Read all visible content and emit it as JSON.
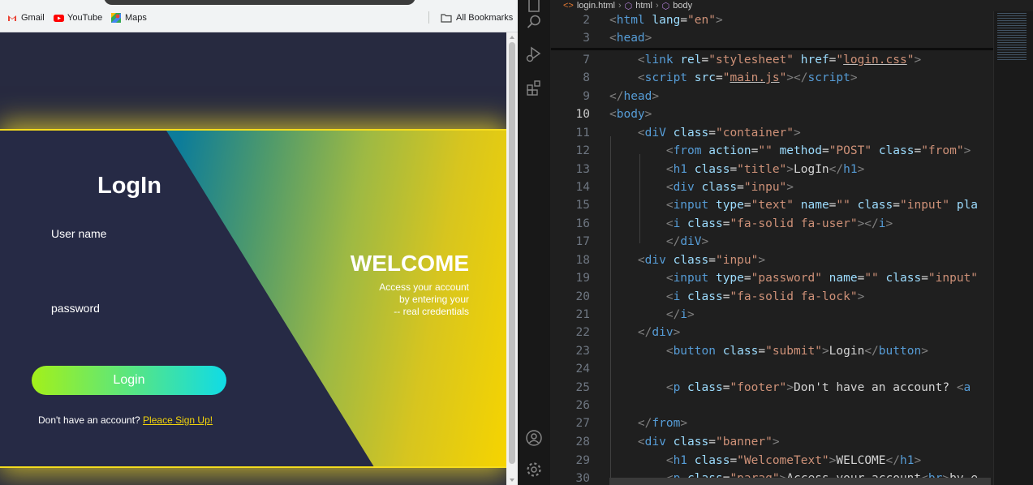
{
  "browser": {
    "bookmarks": {
      "gmail": "Gmail",
      "youtube": "YouTube",
      "maps": "Maps",
      "all_bookmarks": "All Bookmarks"
    },
    "login_page": {
      "title": "LogIn",
      "username_label": "User name",
      "password_label": "password",
      "login_button": "Login",
      "footer_text": "Don't have an account? ",
      "signup_link": "Pleace Sign Up!",
      "welcome_title": "WELCOME",
      "welcome_lines": [
        "Access your account",
        "by entering your",
        "-- real credentials"
      ]
    }
  },
  "editor": {
    "breadcrumbs": [
      "login.html",
      "html",
      "body"
    ],
    "active_line": "10",
    "lines": [
      {
        "num": "2",
        "html": "<span class=\"t\">&lt;</span><span class=\"tag\">html</span> <span class=\"at\">lang</span><span class=\"tx\">=</span><span class=\"st\">\"en\"</span><span class=\"t\">&gt;</span>"
      },
      {
        "num": "3",
        "html": "<span class=\"t\">&lt;</span><span class=\"tag\">head</span><span class=\"t\">&gt;</span>"
      },
      {
        "num": "7",
        "html": "    <span class=\"t\">&lt;</span><span class=\"tag\">link</span> <span class=\"at\">rel</span><span class=\"tx\">=</span><span class=\"st\">\"stylesheet\"</span> <span class=\"at\">href</span><span class=\"tx\">=</span><span class=\"st\">\"<span class=\"st u\">login.css</span>\"</span><span class=\"t\">&gt;</span>"
      },
      {
        "num": "8",
        "html": "    <span class=\"t\">&lt;</span><span class=\"tag\">script</span> <span class=\"at\">src</span><span class=\"tx\">=</span><span class=\"st\">\"<span class=\"st u\">main.js</span>\"</span><span class=\"t\">&gt;&lt;/</span><span class=\"tag\">script</span><span class=\"t\">&gt;</span>"
      },
      {
        "num": "9",
        "html": "<span class=\"t\">&lt;/</span><span class=\"tag\">head</span><span class=\"t\">&gt;</span>"
      },
      {
        "num": "10",
        "html": "<span class=\"t\">&lt;</span><span class=\"tag\">body</span><span class=\"t\">&gt;</span>"
      },
      {
        "num": "11",
        "html": "    <span class=\"t\">&lt;</span><span class=\"tag\">diV</span> <span class=\"at\">class</span><span class=\"tx\">=</span><span class=\"st\">\"container\"</span><span class=\"t\">&gt;</span>"
      },
      {
        "num": "12",
        "html": "        <span class=\"t\">&lt;</span><span class=\"tag\">from</span> <span class=\"at\">action</span><span class=\"tx\">=</span><span class=\"st\">\"\"</span> <span class=\"at\">method</span><span class=\"tx\">=</span><span class=\"st\">\"POST\"</span> <span class=\"at\">class</span><span class=\"tx\">=</span><span class=\"st\">\"from\"</span><span class=\"t\">&gt;</span>"
      },
      {
        "num": "13",
        "html": "        <span class=\"t\">&lt;</span><span class=\"tag\">h1</span> <span class=\"at\">class</span><span class=\"tx\">=</span><span class=\"st\">\"title\"</span><span class=\"t\">&gt;</span><span class=\"tx\">LogIn</span><span class=\"t\">&lt;/</span><span class=\"tag\">h1</span><span class=\"t\">&gt;</span>"
      },
      {
        "num": "14",
        "html": "        <span class=\"t\">&lt;</span><span class=\"tag\">div</span> <span class=\"at\">class</span><span class=\"tx\">=</span><span class=\"st\">\"inpu\"</span><span class=\"t\">&gt;</span>"
      },
      {
        "num": "15",
        "html": "        <span class=\"t\">&lt;</span><span class=\"tag\">input</span> <span class=\"at\">type</span><span class=\"tx\">=</span><span class=\"st\">\"text\"</span> <span class=\"at\">name</span><span class=\"tx\">=</span><span class=\"st\">\"\"</span> <span class=\"at\">class</span><span class=\"tx\">=</span><span class=\"st\">\"input\"</span> <span class=\"at\">pla</span>"
      },
      {
        "num": "16",
        "html": "        <span class=\"t\">&lt;</span><span class=\"tag\">i</span> <span class=\"at\">class</span><span class=\"tx\">=</span><span class=\"st\">\"fa-solid fa-user\"</span><span class=\"t\">&gt;&lt;/</span><span class=\"tag\">i</span><span class=\"t\">&gt;</span>"
      },
      {
        "num": "17",
        "html": "        <span class=\"t\">&lt;/</span><span class=\"tag\">diV</span><span class=\"t\">&gt;</span>"
      },
      {
        "num": "18",
        "html": "    <span class=\"t\">&lt;</span><span class=\"tag\">div</span> <span class=\"at\">class</span><span class=\"tx\">=</span><span class=\"st\">\"inpu\"</span><span class=\"t\">&gt;</span>"
      },
      {
        "num": "19",
        "html": "        <span class=\"t\">&lt;</span><span class=\"tag\">input</span> <span class=\"at\">type</span><span class=\"tx\">=</span><span class=\"st\">\"password\"</span> <span class=\"at\">name</span><span class=\"tx\">=</span><span class=\"st\">\"\"</span> <span class=\"at\">class</span><span class=\"tx\">=</span><span class=\"st\">\"input\"</span>"
      },
      {
        "num": "20",
        "html": "        <span class=\"t\">&lt;</span><span class=\"tag\">i</span> <span class=\"at\">class</span><span class=\"tx\">=</span><span class=\"st\">\"fa-solid fa-lock\"</span><span class=\"t\">&gt;</span>"
      },
      {
        "num": "21",
        "html": "        <span class=\"t\">&lt;/</span><span class=\"tag\">i</span><span class=\"t\">&gt;</span>"
      },
      {
        "num": "22",
        "html": "    <span class=\"t\">&lt;/</span><span class=\"tag\">div</span><span class=\"t\">&gt;</span>"
      },
      {
        "num": "23",
        "html": "        <span class=\"t\">&lt;</span><span class=\"tag\">button</span> <span class=\"at\">class</span><span class=\"tx\">=</span><span class=\"st\">\"submit\"</span><span class=\"t\">&gt;</span><span class=\"tx\">Login</span><span class=\"t\">&lt;/</span><span class=\"tag\">button</span><span class=\"t\">&gt;</span>"
      },
      {
        "num": "24",
        "html": ""
      },
      {
        "num": "25",
        "html": "        <span class=\"t\">&lt;</span><span class=\"tag\">p</span> <span class=\"at\">class</span><span class=\"tx\">=</span><span class=\"st\">\"footer\"</span><span class=\"t\">&gt;</span><span class=\"tx\">Don't have an account? </span><span class=\"t\">&lt;</span><span class=\"tag\">a</span>"
      },
      {
        "num": "26",
        "html": ""
      },
      {
        "num": "27",
        "html": "    <span class=\"t\">&lt;/</span><span class=\"tag\">from</span><span class=\"t\">&gt;</span>"
      },
      {
        "num": "28",
        "html": "    <span class=\"t\">&lt;</span><span class=\"tag\">div</span> <span class=\"at\">class</span><span class=\"tx\">=</span><span class=\"st\">\"banner\"</span><span class=\"t\">&gt;</span>"
      },
      {
        "num": "29",
        "html": "        <span class=\"t\">&lt;</span><span class=\"tag\">h1</span> <span class=\"at\">class</span><span class=\"tx\">=</span><span class=\"st\">\"WelcomeText\"</span><span class=\"t\">&gt;</span><span class=\"tx\">WELCOME</span><span class=\"t\">&lt;/</span><span class=\"tag\">h1</span><span class=\"t\">&gt;</span>"
      },
      {
        "num": "30",
        "html": "        <span class=\"t\">&lt;</span><span class=\"tag\">p</span> <span class=\"at\">class</span><span class=\"tx\">=</span><span class=\"st\">\"parag\"</span><span class=\"t\">&gt;</span><span class=\"tx\">Access your account</span><span class=\"t\">&lt;</span><span class=\"tag\">br</span><span class=\"t\">&gt;</span><span class=\"tx\">by e</span>"
      }
    ]
  }
}
